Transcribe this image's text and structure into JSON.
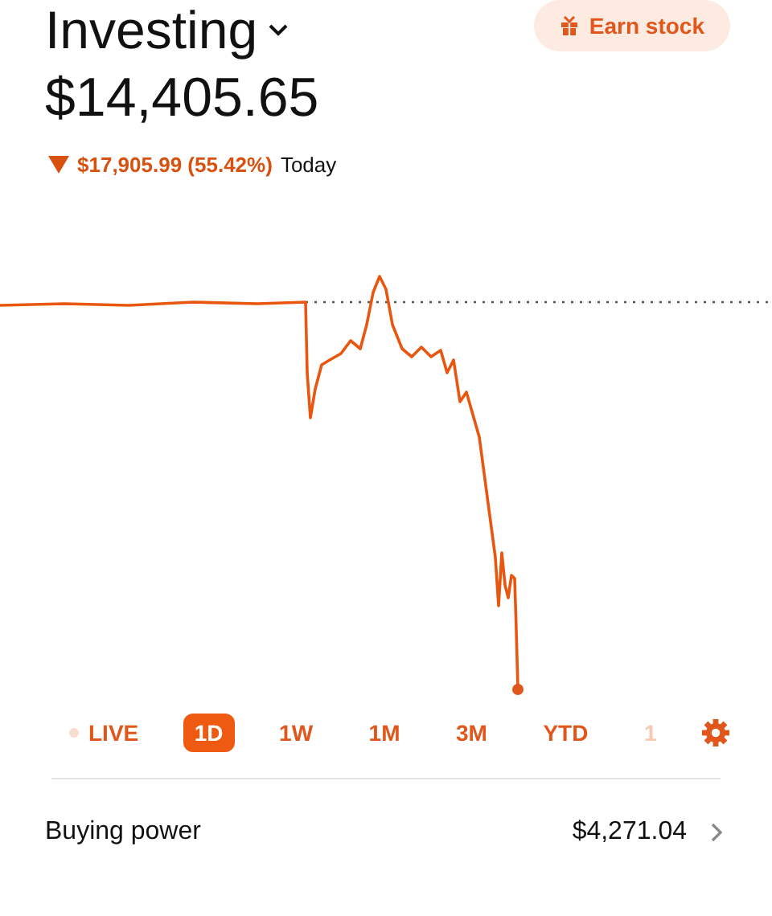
{
  "header": {
    "title": "Investing",
    "button": "Earn stock"
  },
  "portfolio": {
    "value": "$14,405.65",
    "change": "$17,905.99 (55.42%)",
    "period": "Today"
  },
  "ranges": [
    {
      "label": "LIVE",
      "kind": "live",
      "selected": false
    },
    {
      "label": "1D",
      "kind": "range",
      "selected": true
    },
    {
      "label": "1W",
      "kind": "range",
      "selected": false
    },
    {
      "label": "1M",
      "kind": "range",
      "selected": false
    },
    {
      "label": "3M",
      "kind": "range",
      "selected": false
    },
    {
      "label": "YTD",
      "kind": "range",
      "selected": false
    },
    {
      "label": "1",
      "kind": "faded",
      "selected": false
    }
  ],
  "buying_power": {
    "label": "Buying power",
    "value": "$4,271.04"
  }
}
